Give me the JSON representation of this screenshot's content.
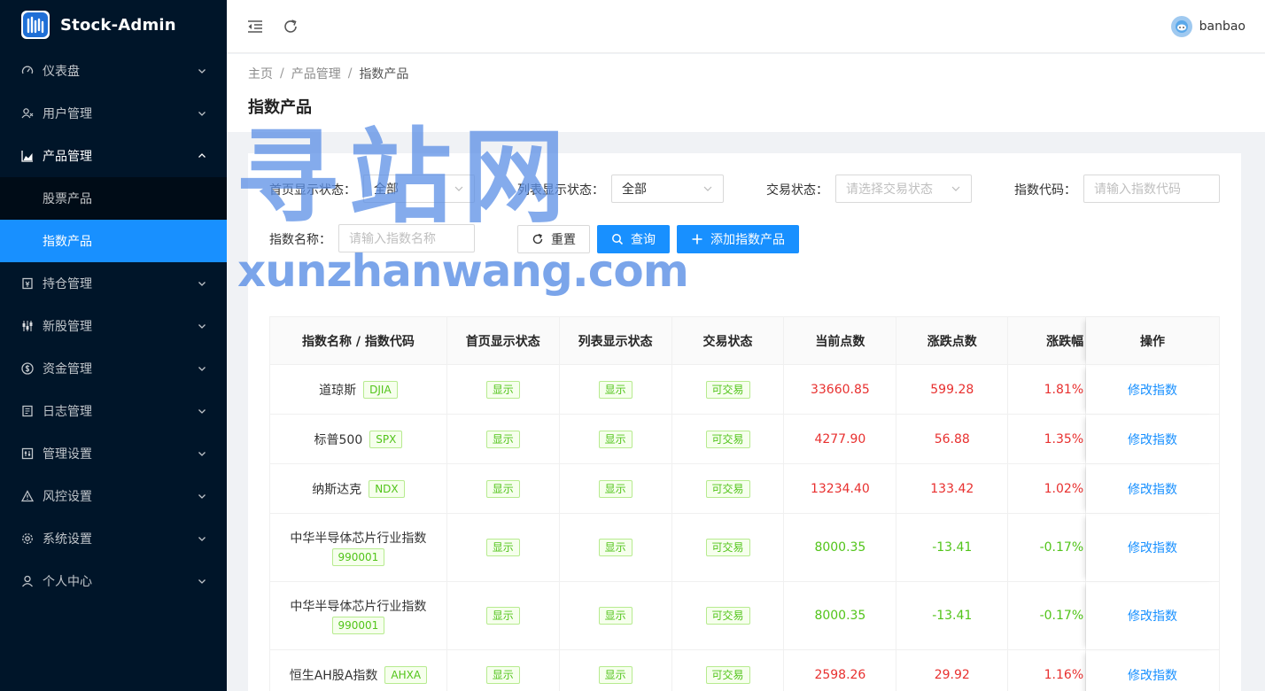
{
  "app": {
    "title": "Stock-Admin"
  },
  "sidebar": {
    "items": [
      {
        "label": "仪表盘",
        "icon": "dashboard-icon"
      },
      {
        "label": "用户管理",
        "icon": "user-manage-icon"
      },
      {
        "label": "产品管理",
        "icon": "area-chart-icon",
        "open": true,
        "children": [
          {
            "label": "股票产品"
          },
          {
            "label": "指数产品",
            "active": true
          }
        ]
      },
      {
        "label": "持仓管理",
        "icon": "account-book-icon"
      },
      {
        "label": "新股管理",
        "icon": "sliders-icon"
      },
      {
        "label": "资金管理",
        "icon": "dollar-icon"
      },
      {
        "label": "日志管理",
        "icon": "profile-icon"
      },
      {
        "label": "管理设置",
        "icon": "control-icon"
      },
      {
        "label": "风控设置",
        "icon": "warning-icon"
      },
      {
        "label": "系统设置",
        "icon": "setting-icon"
      },
      {
        "label": "个人中心",
        "icon": "person-icon"
      }
    ]
  },
  "header": {
    "username": "banbao"
  },
  "breadcrumb": {
    "home": "主页",
    "parent": "产品管理",
    "current": "指数产品",
    "sep": "/"
  },
  "page": {
    "title": "指数产品"
  },
  "filters": {
    "home_status": {
      "label": "首页显示状态：",
      "value": "全部"
    },
    "list_status": {
      "label": "列表显示状态：",
      "value": "全部"
    },
    "trade_status": {
      "label": "交易状态：",
      "placeholder": "请选择交易状态"
    },
    "index_code": {
      "label": "指数代码：",
      "placeholder": "请输入指数代码"
    },
    "index_name": {
      "label": "指数名称：",
      "placeholder": "请输入指数名称"
    }
  },
  "buttons": {
    "reset": "重置",
    "query": "查询",
    "add": "添加指数产品"
  },
  "table": {
    "columns": [
      "指数名称 / 指数代码",
      "首页显示状态",
      "列表显示状态",
      "交易状态",
      "当前点数",
      "涨跌点数",
      "涨跌幅",
      "操作"
    ],
    "rows": [
      {
        "name": "道琼斯",
        "code": "DJIA",
        "home": "显示",
        "list": "显示",
        "trade": "可交易",
        "price": "33660.85",
        "change": "599.28",
        "pct": "1.81%",
        "dir": "up",
        "action": "修改指数"
      },
      {
        "name": "标普500",
        "code": "SPX",
        "home": "显示",
        "list": "显示",
        "trade": "可交易",
        "price": "4277.90",
        "change": "56.88",
        "pct": "1.35%",
        "dir": "up",
        "action": "修改指数"
      },
      {
        "name": "纳斯达克",
        "code": "NDX",
        "home": "显示",
        "list": "显示",
        "trade": "可交易",
        "price": "13234.40",
        "change": "133.42",
        "pct": "1.02%",
        "dir": "up",
        "action": "修改指数"
      },
      {
        "name": "中华半导体芯片行业指数",
        "code": "990001",
        "home": "显示",
        "list": "显示",
        "trade": "可交易",
        "price": "8000.35",
        "change": "-13.41",
        "pct": "-0.17%",
        "dir": "down",
        "action": "修改指数",
        "tall": true
      },
      {
        "name": "中华半导体芯片行业指数",
        "code": "990001",
        "home": "显示",
        "list": "显示",
        "trade": "可交易",
        "price": "8000.35",
        "change": "-13.41",
        "pct": "-0.17%",
        "dir": "down",
        "action": "修改指数",
        "tall": true
      },
      {
        "name": "恒生AH股A指数",
        "code": "AHXA",
        "home": "显示",
        "list": "显示",
        "trade": "可交易",
        "price": "2598.26",
        "change": "29.92",
        "pct": "1.16%",
        "dir": "up",
        "action": "修改指数"
      }
    ]
  },
  "watermark": {
    "big": "寻站网",
    "small": "xunzhanwang.com"
  },
  "colors": {
    "primary": "#1890ff",
    "sidebar": "#001529",
    "up": "#e8302f",
    "down": "#52c41a"
  }
}
